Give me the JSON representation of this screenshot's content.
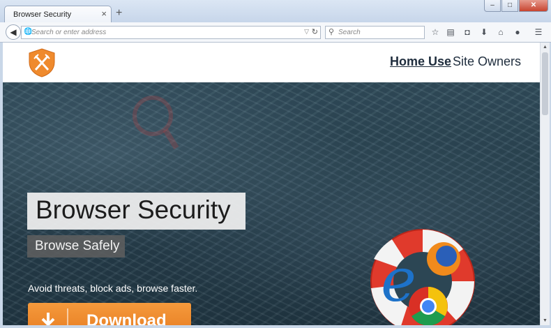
{
  "browser": {
    "tab_title": "Browser Security",
    "tab_close": "×",
    "new_tab": "+",
    "window_buttons": {
      "minimize": "–",
      "maximize": "□",
      "close": "✕"
    },
    "address_placeholder": "Search or enter address",
    "search_placeholder": "Search",
    "toolbar_icons": [
      "bookmark-star-icon",
      "reading-list-icon",
      "pocket-icon",
      "download-icon",
      "home-icon",
      "chat-icon",
      "menu-icon"
    ]
  },
  "site": {
    "nav": {
      "home_use": "Home Use",
      "site_owners": "Site Owners"
    },
    "hero": {
      "title": "Browser Security",
      "subtitle": "Browse Safely",
      "tagline": "Avoid threats, block ads, browse faster.",
      "download_label": "Download"
    },
    "colors": {
      "accent": "#ef8a2d",
      "hero_bg": "#2c4654",
      "nav_text": "#1f2d3d"
    }
  }
}
